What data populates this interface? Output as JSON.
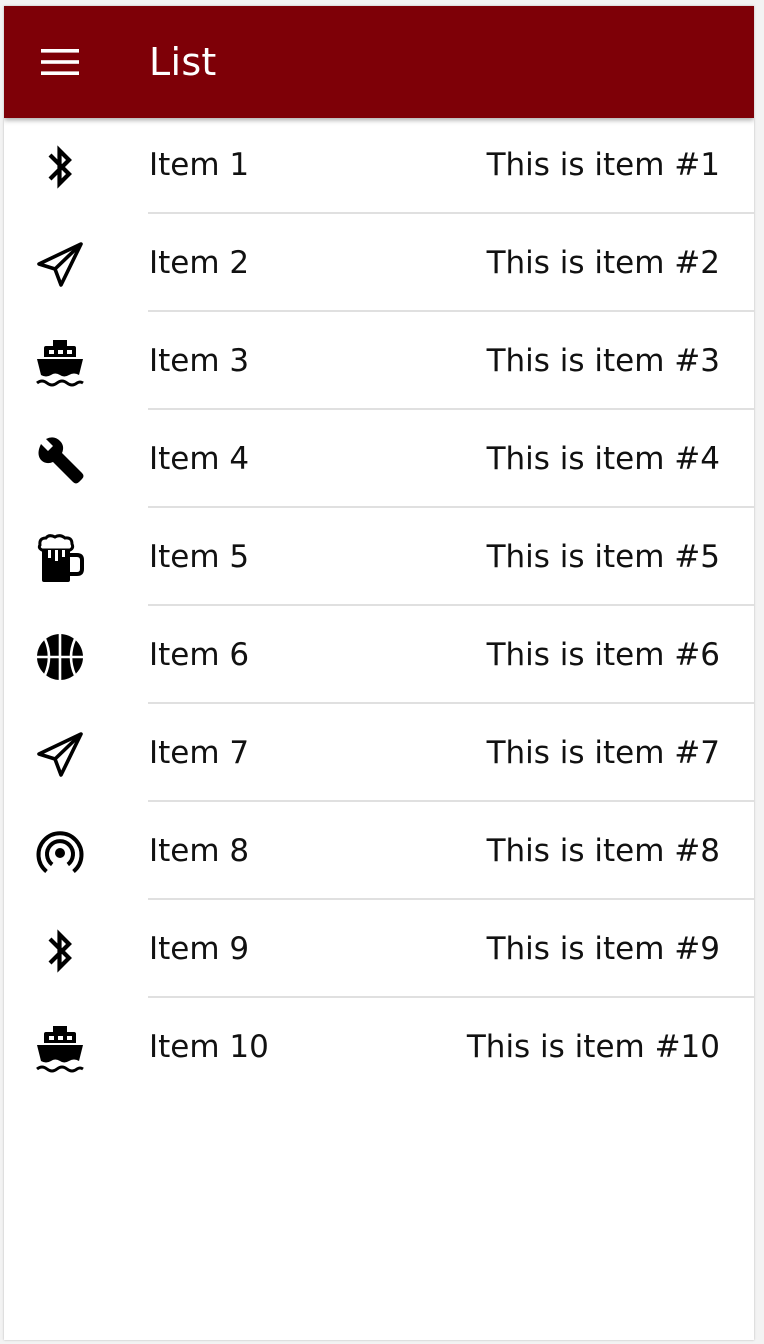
{
  "app_bar": {
    "title": "List",
    "menu_icon": "menu-icon",
    "background_color": "#7e0007"
  },
  "list": {
    "items": [
      {
        "icon": "bluetooth-icon",
        "label": "Item 1",
        "detail": "This is item #1"
      },
      {
        "icon": "send-icon",
        "label": "Item 2",
        "detail": "This is item #2"
      },
      {
        "icon": "boat-icon",
        "label": "Item 3",
        "detail": "This is item #3"
      },
      {
        "icon": "wrench-icon",
        "label": "Item 4",
        "detail": "This is item #4"
      },
      {
        "icon": "beer-icon",
        "label": "Item 5",
        "detail": "This is item #5"
      },
      {
        "icon": "basketball-icon",
        "label": "Item 6",
        "detail": "This is item #6"
      },
      {
        "icon": "send-icon",
        "label": "Item 7",
        "detail": "This is item #7"
      },
      {
        "icon": "broadcast-icon",
        "label": "Item 8",
        "detail": "This is item #8"
      },
      {
        "icon": "bluetooth-icon",
        "label": "Item 9",
        "detail": "This is item #9"
      },
      {
        "icon": "boat-icon",
        "label": "Item 10",
        "detail": "This is item #10"
      }
    ]
  }
}
